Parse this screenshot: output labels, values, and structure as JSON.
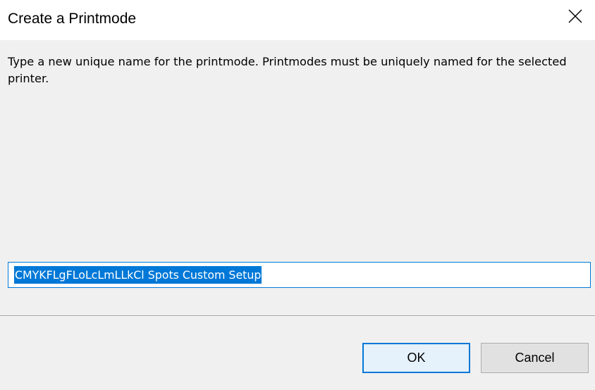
{
  "dialog": {
    "title": "Create a Printmode",
    "message": "Type a new unique name for the printmode. Printmodes must be uniquely named for the selected printer.",
    "name_value": "CMYKFLgFLoLcLmLLkCl Spots Custom Setup",
    "ok_label": "OK",
    "cancel_label": "Cancel",
    "close_icon": "close-icon"
  },
  "colors": {
    "accent": "#0078d7",
    "background": "#f0f0f0",
    "titlebar": "#ffffff",
    "selection_text": "#ffffff"
  }
}
